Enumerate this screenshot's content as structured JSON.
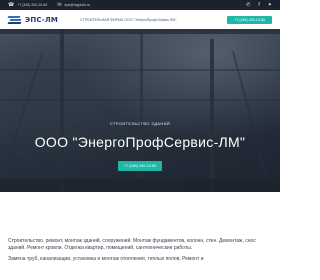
{
  "topbar": {
    "phone": "+7 (345) 200-10-60",
    "email": "eps@myphub.ru",
    "phone_icon": "phone-icon",
    "email_icon": "envelope-icon",
    "social": [
      "vk-icon",
      "facebook-icon",
      "twitter-icon"
    ],
    "social_glyphs": [
      "✆",
      "f",
      "✦"
    ]
  },
  "header": {
    "logo_text": "ЭПС-ЛМ",
    "tagline": "СТРОИТЕЛЬНАЯ ФИРМА ООО \"ЭнергоПрофСервис-ЛМ\"",
    "phone_button": "+7 (345) 200-10-60"
  },
  "hero": {
    "subtitle": "СТРОИТЕЛЬСТВО ЗДАНИЙ",
    "title": "ООО \"ЭнергоПрофСервис-ЛМ\"",
    "button": "+7 (345) 200-10-60"
  },
  "about": {
    "paragraph1": "Строительство, ремонт, монтаж зданий, сооружений. Монтаж фундаментов, колонн, стен. Демонтаж, снос зданий. Ремонт кровли. Отделка квартир, помещений, сантехнические работы.",
    "paragraph2": "Замена труб, канализации, установка и монтаж отопления, теплых полов. Ремонт и"
  },
  "colors": {
    "accent": "#1fb7a6",
    "brand": "#1f3f6e",
    "topbar_bg": "#1a2230"
  }
}
